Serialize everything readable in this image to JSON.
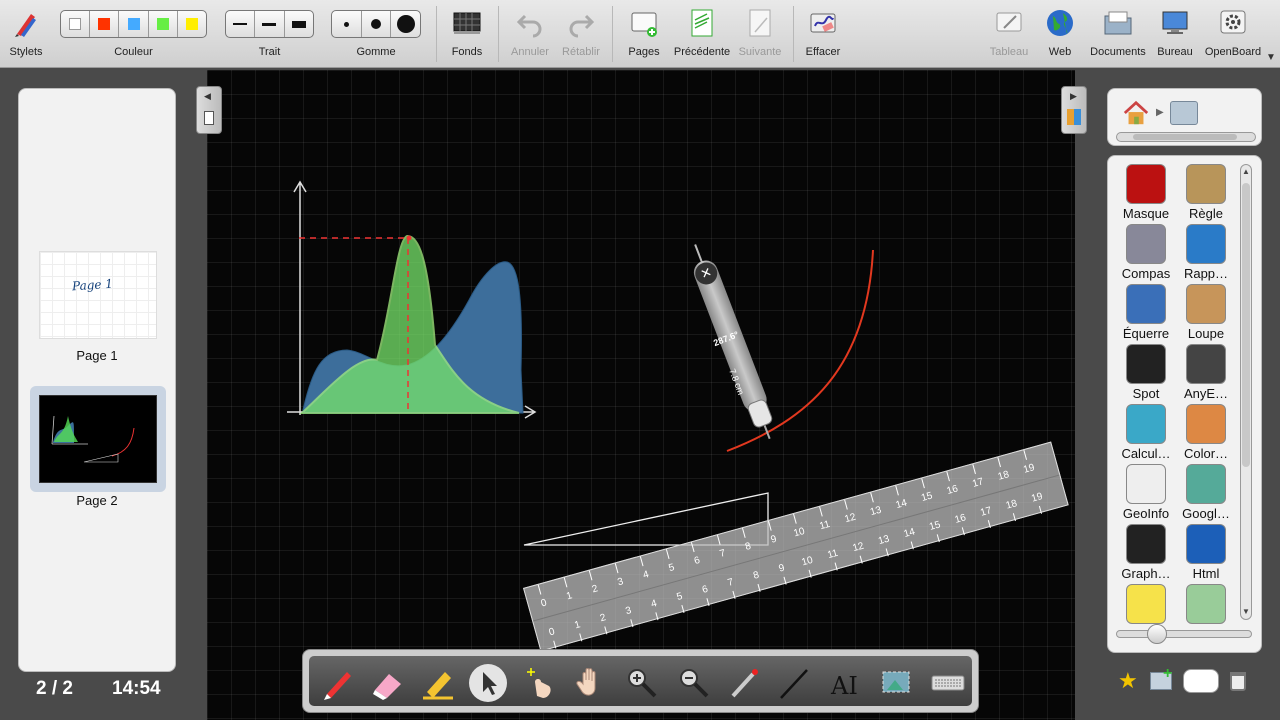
{
  "toolbar": {
    "stylets": "Stylets",
    "couleur": "Couleur",
    "trait": "Trait",
    "gomme": "Gomme",
    "fonds": "Fonds",
    "annuler": "Annuler",
    "retablir": "Rétablir",
    "pages": "Pages",
    "precedente": "Précédente",
    "suivante": "Suivante",
    "effacer": "Effacer",
    "tableau": "Tableau",
    "web": "Web",
    "documents": "Documents",
    "bureau": "Bureau",
    "openboard": "OpenBoard",
    "colors": [
      "#ffffff",
      "#ff3300",
      "#44aaff",
      "#66ee44",
      "#ffee00"
    ]
  },
  "pages": {
    "items": [
      {
        "label": "Page 1",
        "note": "Page 1"
      },
      {
        "label": "Page 2"
      }
    ],
    "selected": "Page 2"
  },
  "status": {
    "page_counter": "2 / 2",
    "clock": "14:54"
  },
  "board": {
    "protractor_angle": "287.6°",
    "protractor_length": "7.8 cm"
  },
  "ruler": {
    "top_ticks": [
      "0",
      "1",
      "2",
      "3",
      "4",
      "5",
      "6",
      "7",
      "8",
      "9",
      "10",
      "11",
      "12",
      "13",
      "14",
      "15",
      "16",
      "17",
      "18",
      "19"
    ],
    "bottom_ticks": [
      "0",
      "1",
      "2",
      "3",
      "4",
      "5",
      "6",
      "7",
      "8",
      "9",
      "10",
      "11",
      "12",
      "13",
      "14",
      "15",
      "16",
      "17",
      "18",
      "19"
    ]
  },
  "library": {
    "apps": [
      {
        "label": "Masque",
        "icon": "mask-icon"
      },
      {
        "label": "Règle",
        "icon": "ruler-icon"
      },
      {
        "label": "Compas",
        "icon": "compass-icon"
      },
      {
        "label": "Rapp…",
        "icon": "protractor-icon"
      },
      {
        "label": "Équerre",
        "icon": "set-square-icon"
      },
      {
        "label": "Loupe",
        "icon": "magnifier-icon"
      },
      {
        "label": "Spot",
        "icon": "spotlight-icon"
      },
      {
        "label": "AnyE…",
        "icon": "embed-icon"
      },
      {
        "label": "Calcul…",
        "icon": "calculator-icon"
      },
      {
        "label": "Color…",
        "icon": "color-picker-icon"
      },
      {
        "label": "GeoInfo",
        "icon": "world-map-icon"
      },
      {
        "label": "Googl…",
        "icon": "maps-icon"
      },
      {
        "label": "Graph…",
        "icon": "graph-icon"
      },
      {
        "label": "Html",
        "icon": "html-icon"
      },
      {
        "label": "",
        "icon": "notes-icon"
      },
      {
        "label": "",
        "icon": "search-map-icon"
      }
    ]
  }
}
